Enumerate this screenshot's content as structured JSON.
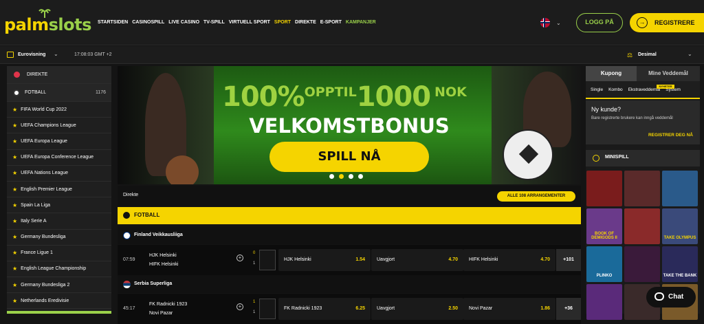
{
  "brand": {
    "logo_part1": "palm",
    "logo_part2": "slots"
  },
  "nav": [
    "STARTSIDEN",
    "CASINOSPILL",
    "LIVE CASINO",
    "TV-SPILL",
    "VIRTUELL SPORT",
    "SPORT",
    "DIREKTE",
    "E-SPORT",
    "KAMPANJER"
  ],
  "header": {
    "login": "LOGG PÅ",
    "register": "REGISTRERE",
    "register_icon": "arrow-right-icon",
    "language": "NO"
  },
  "subbar": {
    "event": "Eurovisning",
    "clock": "17:08:03 GMT +2",
    "odds_format": "Desimal"
  },
  "sidebar": {
    "live": "DIREKTE",
    "football": "FOTBALL",
    "football_count": "1176",
    "leagues": [
      "FIFA World Cup 2022",
      "UEFA Champions League",
      "UEFA Europa League",
      "UEFA Europa Conference League",
      "UEFA Nations League",
      "English Premier League",
      "Spain La Liga",
      "Italy Serie A",
      "Germany Bundesliga",
      "France Ligue 1",
      "English League Championship",
      "Germany Bundesliga 2",
      "Netherlands Eredivisie"
    ]
  },
  "banner": {
    "pct": "100%",
    "upto": "OPPTIL",
    "amount": "1000",
    "currency": "NOK",
    "headline": "VELKOMSTBONUS",
    "cta": "SPILL NÅ",
    "active_dot": 1
  },
  "live": {
    "title": "Direkte",
    "all_events": "ALLE 108 ARRANGEMENTER",
    "sport": "FOTBALL"
  },
  "leagues": [
    {
      "name": "Finland Veikkausliiga",
      "flag_color": "#ffffff",
      "cross_color": "#003580"
    },
    {
      "name": "Serbia Superliga",
      "flag_color": "#c6363c",
      "cross_color": "#0c4076"
    }
  ],
  "matches": [
    {
      "time": "07:59",
      "home": "HJK Helsinki",
      "away": "HIFK Helsinki",
      "score_home": "0",
      "score_away": "1",
      "odds": [
        {
          "name": "HJK Helsinki",
          "value": "1.54"
        },
        {
          "name": "Uavgjort",
          "value": "4.70"
        },
        {
          "name": "HIFK Helsinki",
          "value": "4.70"
        }
      ],
      "more": "+101"
    },
    {
      "time": "45:17",
      "home": "FK Radnicki 1923",
      "away": "Novi Pazar",
      "score_home": "1",
      "score_away": "1",
      "odds": [
        {
          "name": "FK Radnicki 1923",
          "value": "6.25"
        },
        {
          "name": "Uavgjort",
          "value": "2.50"
        },
        {
          "name": "Novi Pazar",
          "value": "1.86"
        }
      ],
      "more": "+36"
    }
  ],
  "betslip": {
    "tab1": "Kupong",
    "tab2": "Mine Veddemål",
    "subtabs": [
      "Single",
      "Kombo",
      "Ekstraveddemål",
      "System"
    ],
    "new_badge": "NYHETER",
    "new_customer": "Ny kunde?",
    "new_customer_text": "Bare registrerte brukere kan inngå veddemål",
    "register_cta": "REGISTRER DEG NÅ"
  },
  "minigames": {
    "title": "MINISPILL",
    "games": [
      {
        "label": "",
        "bg": "#7a1c1c"
      },
      {
        "label": "",
        "bg": "#5a2a2a"
      },
      {
        "label": "",
        "bg": "#2a5a8a"
      },
      {
        "label": "BOOK OF DEMIGODS II",
        "bg": "#6a3a8a"
      },
      {
        "label": "",
        "bg": "#8a2a2a"
      },
      {
        "label": "TAKE OLYMPUS",
        "bg": "#3a4a7a"
      },
      {
        "label": "PLINKO",
        "bg": "#1a6a9a"
      },
      {
        "label": "",
        "bg": "#3a1a3a"
      },
      {
        "label": "TAKE THE BANK",
        "bg": "#2a2a5a"
      },
      {
        "label": "",
        "bg": "#5a2a7a"
      },
      {
        "label": "",
        "bg": "#3a2a2a"
      },
      {
        "label": "",
        "bg": "#7a5a2a"
      }
    ]
  },
  "chat": "Chat"
}
